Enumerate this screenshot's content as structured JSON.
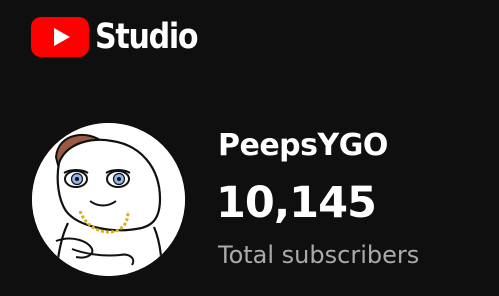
{
  "app": {
    "name": "Studio",
    "logo_icon": "youtube-play-icon",
    "accent_color": "#ff0000"
  },
  "channel": {
    "name": "PeepsYGO",
    "subscriber_count": "10,145",
    "subscriber_label": "Total subscribers",
    "avatar_icon": "channel-avatar-cartoon"
  }
}
